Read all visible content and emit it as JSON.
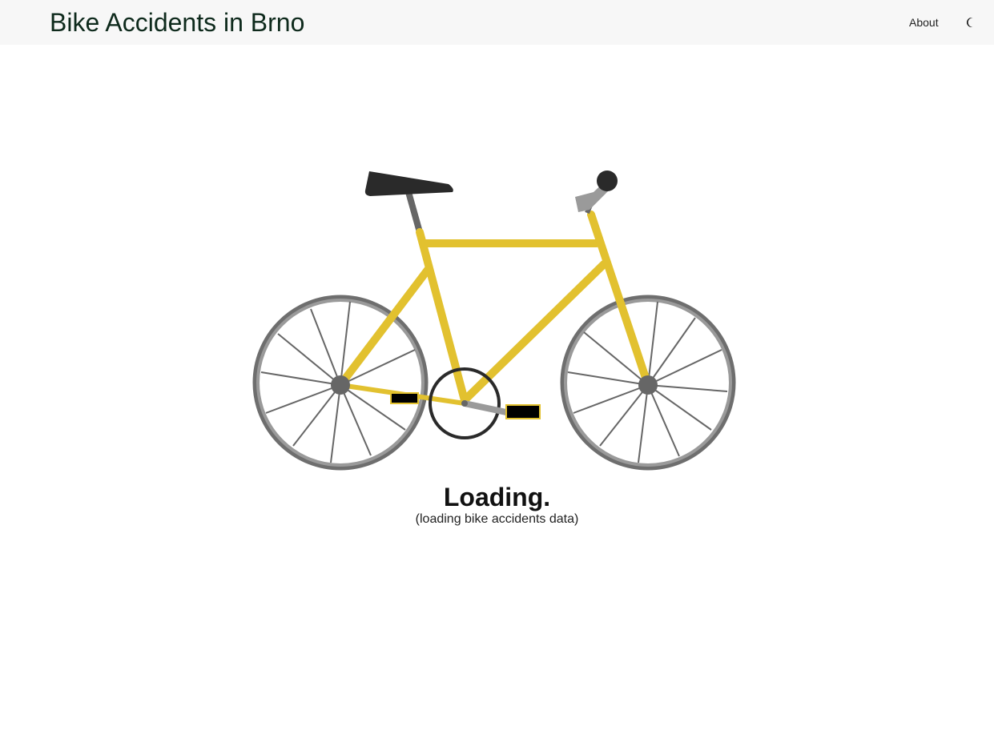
{
  "header": {
    "title": "Bike Accidents in Brno",
    "about_label": "About",
    "theme_icon": "moon-icon"
  },
  "loading": {
    "title": "Loading.",
    "subtitle": "(loading bike accidents data)"
  },
  "colors": {
    "navbar_bg": "#f7f7f7",
    "frame": "#e2c12f",
    "tire": "#7a7a7a",
    "hub": "#666666",
    "saddle": "#2a2a2a",
    "pedal": "#000000",
    "crank": "#9a9a9a"
  }
}
